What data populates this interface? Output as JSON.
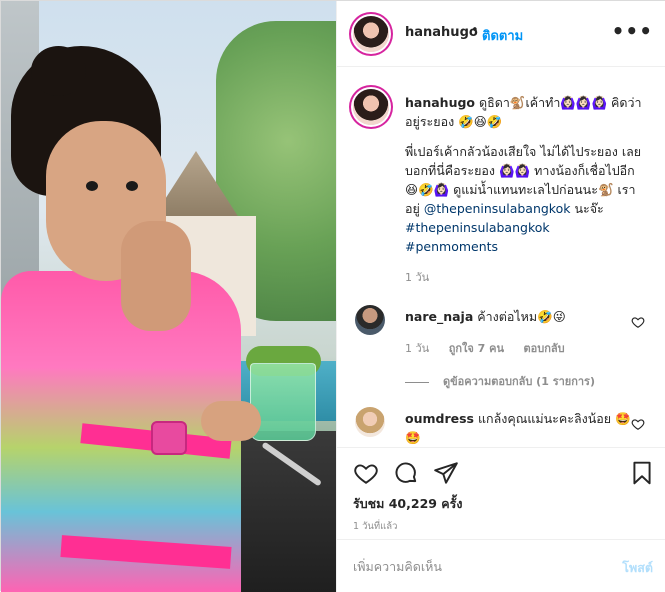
{
  "header": {
    "username": "hanahugo",
    "separator": "•",
    "follow_label": "ติดตาม",
    "more_icon": "ellipsis-icon",
    "more_label": "•••"
  },
  "caption": {
    "username": "hanahugo",
    "line1": "ดูธิดา🐒เค้าทำ🙆🏻‍♀️🙆🏻‍♀️🙆🏻‍♀️ คิดว่าอยู่ระยอง 🤣😆🤣",
    "line2": "พี่เปอร์เค้ากลัวน้องเสียใจ ไม่ได้ไประยอง เลยบอกที่นี่คือระยอง 🙆🏻‍♀️🙆🏻‍♀️ ทางน้องก็เชื่อไปอีก 😆🤣🙆🏻‍♀️ ดูแม่น้ำแทนทะเลไปก่อนนะ🐒 เราอยู่",
    "mention": "@thepeninsulabangkok",
    "after_mention": " นะจ๊ะ",
    "hashtag1": "#thepeninsulabangkok",
    "hashtag2": "#penmoments",
    "time": "1 วัน"
  },
  "comments": [
    {
      "username": "nare_naja",
      "text": "ค้างต่อไหม🤣😜",
      "time": "1 วัน",
      "likes": "ถูกใจ 7 คน",
      "reply": "ตอบกลับ",
      "view_replies": "ดูข้อความตอบกลับ (1 รายการ)"
    },
    {
      "username": "oumdress",
      "text": "แกล้งคุณแม่นะคะลิงน้อย 🤩🤩"
    }
  ],
  "actions": {
    "like_icon": "heart-icon",
    "comment_icon": "comment-icon",
    "share_icon": "paper-plane-icon",
    "save_icon": "bookmark-icon",
    "likes_text": "รับชม 40,229 ครั้ง",
    "post_time": "1 วันที่แล้ว"
  },
  "add_comment": {
    "placeholder": "เพิ่มความคิดเห็น",
    "post_label": "โพสต์"
  },
  "colors": {
    "link_blue": "#0095f6",
    "tag_blue": "#00376b",
    "muted": "#8e8e8e",
    "post_disabled": "#b2dffc"
  }
}
